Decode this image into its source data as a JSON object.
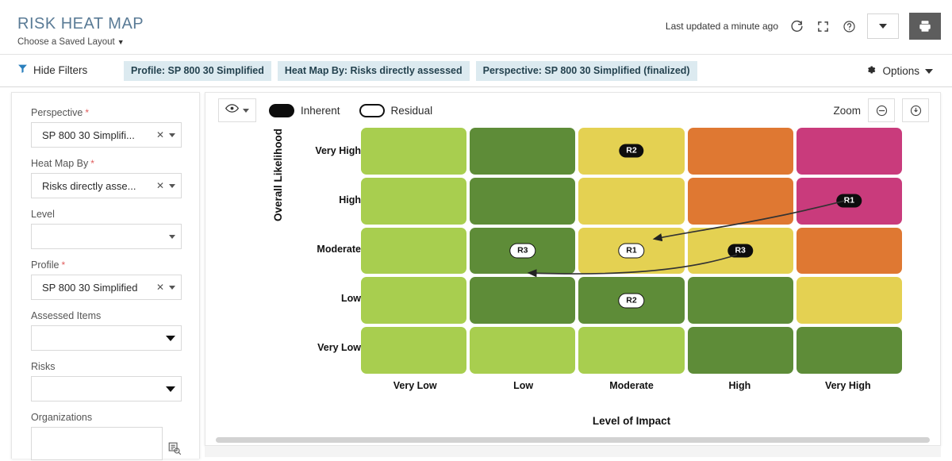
{
  "header": {
    "title": "RISK HEAT MAP",
    "saved_layout": "Choose a Saved Layout",
    "last_updated": "Last updated a minute ago",
    "icons": {
      "refresh": "refresh-icon",
      "fullscreen": "fullscreen-icon",
      "help": "help-icon",
      "print": "print-icon"
    }
  },
  "filterbar": {
    "hide_filters": "Hide Filters",
    "chips": [
      "Profile: SP 800 30 Simplified",
      "Heat Map By: Risks directly assessed",
      "Perspective: SP 800 30 Simplified (finalized)"
    ],
    "options": "Options"
  },
  "sidebar": {
    "fields": [
      {
        "label": "Perspective",
        "required": true,
        "value": "SP 800 30 Simplifi...",
        "clearable": true,
        "placeholder": ""
      },
      {
        "label": "Heat Map By",
        "required": true,
        "value": "Risks directly asse...",
        "clearable": true,
        "placeholder": ""
      },
      {
        "label": "Level",
        "required": false,
        "value": "",
        "clearable": false,
        "placeholder": ""
      },
      {
        "label": "Profile",
        "required": true,
        "value": "SP 800 30 Simplified",
        "clearable": true,
        "placeholder": ""
      },
      {
        "label": "Assessed Items",
        "required": false,
        "value": "",
        "clearable": false,
        "placeholder": ""
      },
      {
        "label": "Risks",
        "required": false,
        "value": "",
        "clearable": false,
        "placeholder": ""
      },
      {
        "label": "Organizations",
        "required": false,
        "value": "",
        "clearable": false,
        "placeholder": ""
      }
    ]
  },
  "chart_toolbar": {
    "legend_inherent": "Inherent",
    "legend_residual": "Residual",
    "zoom_label": "Zoom",
    "zoom_out": "zoom-out-icon",
    "zoom_reset": "zoom-reset-icon",
    "eye": "eye-icon"
  },
  "chart_data": {
    "type": "heatmap",
    "title": "RISK HEAT MAP",
    "xlabel": "Level of Impact",
    "ylabel": "Overall Likelihood",
    "categories_x": [
      "Very Low",
      "Low",
      "Moderate",
      "High",
      "Very High"
    ],
    "categories_y": [
      "Very High",
      "High",
      "Moderate",
      "Low",
      "Very Low"
    ],
    "legend": [
      {
        "name": "Inherent",
        "style": "filled-black-pill"
      },
      {
        "name": "Residual",
        "style": "outlined-white-pill"
      }
    ],
    "colors": {
      "light_green": "#a8ce4f",
      "dark_green": "#5e8c38",
      "yellow": "#e4d152",
      "orange": "#df7832",
      "pink": "#c93b7c"
    },
    "cells": [
      [
        "light_green",
        "dark_green",
        "yellow",
        "orange",
        "pink"
      ],
      [
        "light_green",
        "dark_green",
        "yellow",
        "orange",
        "pink"
      ],
      [
        "light_green",
        "dark_green",
        "yellow",
        "yellow",
        "orange"
      ],
      [
        "light_green",
        "dark_green",
        "dark_green",
        "dark_green",
        "yellow"
      ],
      [
        "light_green",
        "light_green",
        "light_green",
        "dark_green",
        "dark_green"
      ]
    ],
    "markers": [
      {
        "label": "R2",
        "type": "Inherent",
        "impact": "Moderate",
        "likelihood": "Very High",
        "col": 2,
        "row": 0
      },
      {
        "label": "R1",
        "type": "Inherent",
        "impact": "Very High",
        "likelihood": "High",
        "col": 4,
        "row": 1
      },
      {
        "label": "R3",
        "type": "Residual",
        "impact": "Low",
        "likelihood": "Moderate",
        "col": 1,
        "row": 2
      },
      {
        "label": "R1",
        "type": "Residual",
        "impact": "Moderate",
        "likelihood": "Moderate",
        "col": 2,
        "row": 2
      },
      {
        "label": "R3",
        "type": "Inherent",
        "impact": "High",
        "likelihood": "Moderate",
        "col": 3,
        "row": 2
      },
      {
        "label": "R2",
        "type": "Residual",
        "impact": "Moderate",
        "likelihood": "Low",
        "col": 2,
        "row": 3
      }
    ],
    "connectors": [
      {
        "from": "R1 Inherent (Very High, High)",
        "to": "R1 Residual (Moderate, Moderate)"
      },
      {
        "from": "R3 Inherent (High, Moderate)",
        "to": "R3 Residual (Low, Moderate)"
      }
    ]
  }
}
